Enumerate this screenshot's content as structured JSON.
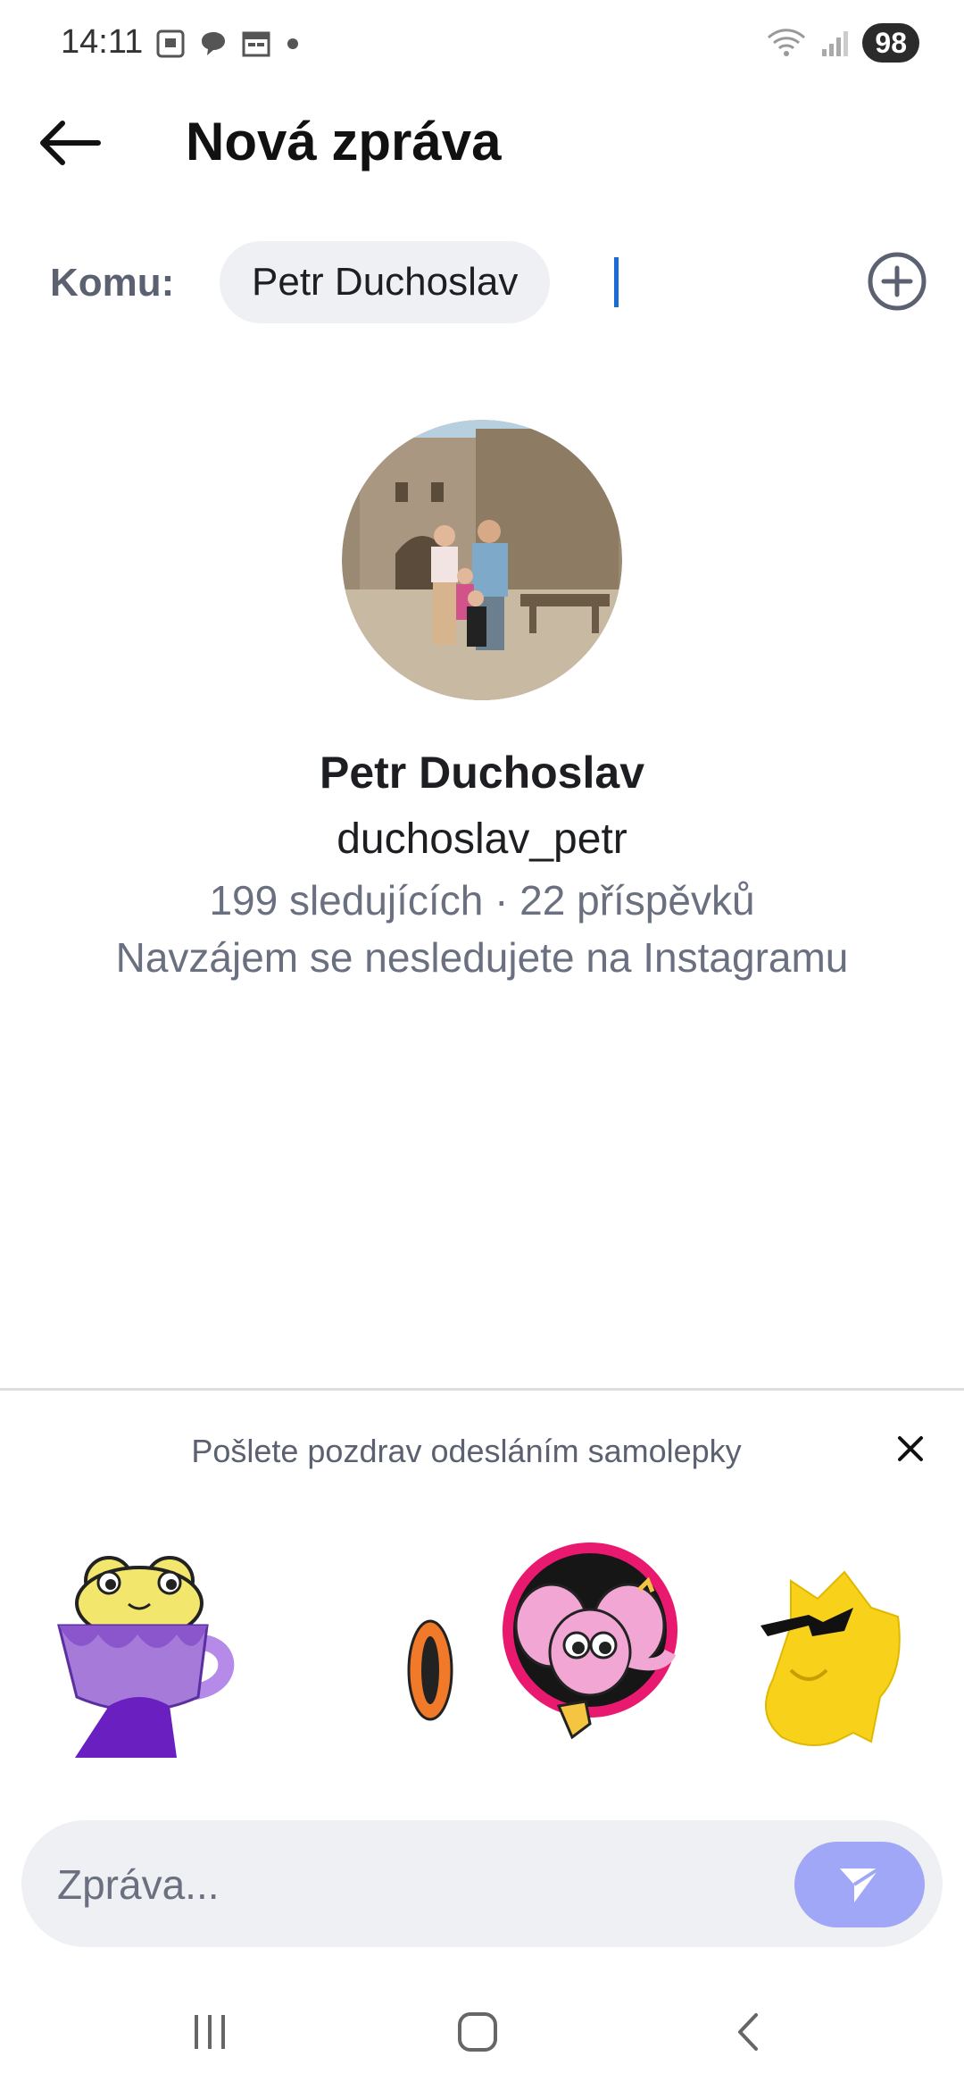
{
  "status_bar": {
    "time": "14:11",
    "battery": "98",
    "icons": [
      "screenshot-icon",
      "chat-bubble-icon",
      "calendar-icon",
      "dot-icon",
      "wifi-icon",
      "signal-icon"
    ]
  },
  "header": {
    "title": "Nová zpráva",
    "back_icon": "back-arrow-icon"
  },
  "recipient": {
    "label": "Komu:",
    "chip": "Petr Duchoslav",
    "add_icon": "add-circle-icon"
  },
  "profile": {
    "name": "Petr Duchoslav",
    "username": "duchoslav_petr",
    "stats": "199 sledujících · 22 příspěvků",
    "follow_status": "Navzájem se nesledujete na Instagramu"
  },
  "stickers": {
    "prompt": "Pošlete pozdrav odesláním samolepky",
    "items": [
      "frog-cup-sticker",
      "ring-sticker",
      "pink-elephant-sticker",
      "yellow-cool-sticker"
    ]
  },
  "composer": {
    "placeholder": "Zpráva...",
    "send_icon": "send-icon"
  },
  "nav_bar": {
    "items": [
      "recent-apps-icon",
      "home-icon",
      "back-icon"
    ]
  },
  "colors": {
    "accent": "#1a6bd6",
    "send_button": "#9fa7f6",
    "secondary_text": "#6b7080",
    "chip_background": "#eef0f3"
  }
}
